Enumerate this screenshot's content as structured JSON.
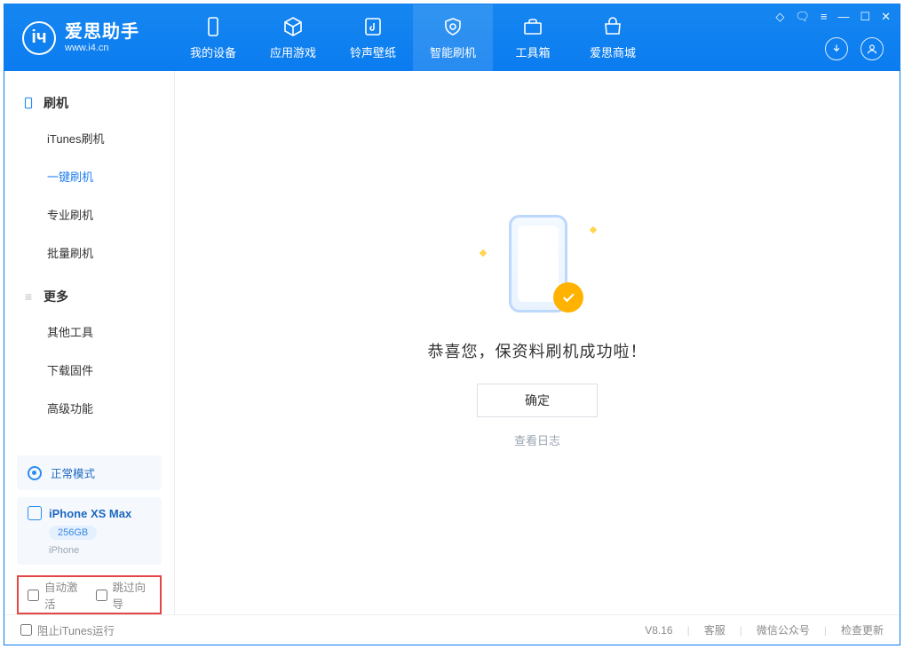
{
  "app": {
    "name_cn": "爱思助手",
    "url": "www.i4.cn"
  },
  "nav": {
    "tabs": [
      "我的设备",
      "应用游戏",
      "铃声壁纸",
      "智能刷机",
      "工具箱",
      "爱思商城"
    ],
    "active": 3
  },
  "sidebar": {
    "group1": {
      "title": "刷机",
      "items": [
        "iTunes刷机",
        "一键刷机",
        "专业刷机",
        "批量刷机"
      ],
      "active": 1
    },
    "group2": {
      "title": "更多",
      "items": [
        "其他工具",
        "下载固件",
        "高级功能"
      ]
    },
    "mode_label": "正常模式",
    "device": {
      "name": "iPhone XS Max",
      "capacity": "256GB",
      "subtype": "iPhone"
    },
    "chk1": "自动激活",
    "chk2": "跳过向导"
  },
  "main": {
    "message": "恭喜您，保资料刷机成功啦！",
    "ok": "确定",
    "loglink": "查看日志"
  },
  "status": {
    "block_itunes": "阻止iTunes运行",
    "version": "V8.16",
    "links": [
      "客服",
      "微信公众号",
      "检查更新"
    ]
  }
}
